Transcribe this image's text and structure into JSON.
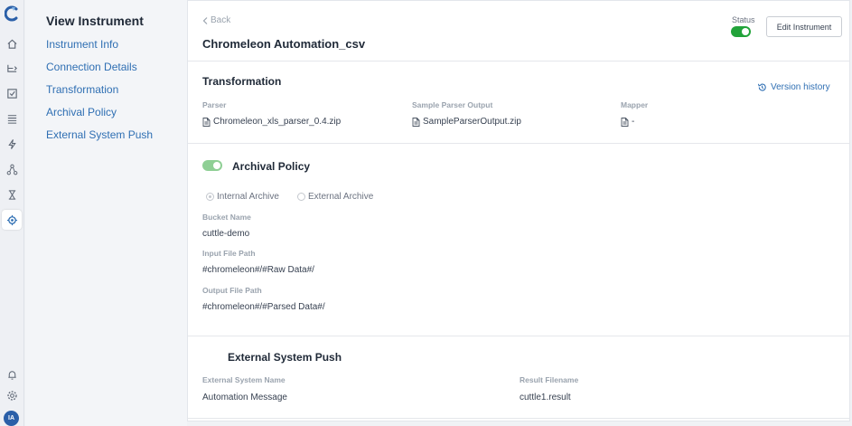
{
  "colors": {
    "accent": "#2f6fb3",
    "toggle_on": "#22a33a",
    "toggle_on_pale": "#8fcf95",
    "avatar_bg": "#2a5fa8"
  },
  "rail": {
    "icons": [
      "home-icon",
      "flow-icon",
      "checklist-icon",
      "list-icon",
      "lightning-icon",
      "network-icon",
      "hourglass-icon",
      "instrument-icon",
      "bell-icon",
      "gear-icon"
    ],
    "active": "instrument-icon",
    "avatar_initials": "IA"
  },
  "sidenav": {
    "title": "View Instrument",
    "items": [
      "Instrument Info",
      "Connection Details",
      "Transformation",
      "Archival Policy",
      "External System Push"
    ]
  },
  "header": {
    "back_label": "Back",
    "instrument_name": "Chromeleon Automation_csv",
    "status_label": "Status",
    "status_on": true,
    "edit_label": "Edit Instrument"
  },
  "transformation": {
    "title": "Transformation",
    "version_history_label": "Version history",
    "parser_label": "Parser",
    "parser_value": "Chromeleon_xls_parser_0.4.zip",
    "sample_output_label": "Sample Parser Output",
    "sample_output_value": "SampleParserOutput.zip",
    "mapper_label": "Mapper",
    "mapper_value": "-"
  },
  "archival": {
    "title": "Archival Policy",
    "enabled": true,
    "options": [
      "Internal Archive",
      "External Archive"
    ],
    "selected": "Internal Archive",
    "bucket_label": "Bucket Name",
    "bucket_value": "cuttle-demo",
    "input_path_label": "Input File Path",
    "input_path_value": "#chromeleon#/#Raw Data#/",
    "output_path_label": "Output File Path",
    "output_path_value": "#chromeleon#/#Parsed Data#/"
  },
  "external_push": {
    "title": "External System Push",
    "system_name_label": "External System Name",
    "system_name_value": "Automation Message",
    "result_filename_label": "Result Filename",
    "result_filename_value": "cuttle1.result"
  }
}
